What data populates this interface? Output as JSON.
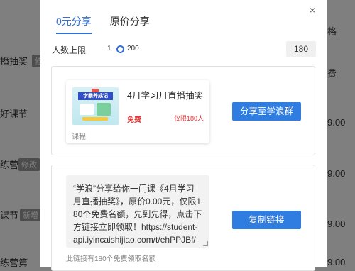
{
  "background": {
    "left_items": [
      "播抽奖",
      "好课节",
      "练营",
      "课节",
      "练营第"
    ],
    "left_tags": [
      "修改",
      "新增"
    ],
    "right_items": [
      "格",
      "费",
      "9.00",
      "9.00",
      "9.00",
      "9.00"
    ]
  },
  "modal": {
    "tabs": [
      {
        "label": "0元分享",
        "active": true
      },
      {
        "label": "原价分享",
        "active": false
      }
    ],
    "close_symbol": "×",
    "limit": {
      "label": "人数上限",
      "min": "1",
      "max": "200",
      "value": "180"
    },
    "card": {
      "thumb_text": "学霸养成记",
      "title": "4月学习月直播抽奖",
      "price": "免费",
      "limit_text": "仅限180人",
      "category": "课程"
    },
    "share_group_button": "分享至学浪群",
    "share_text": "“学浪”分享给你一门课《4月学习月直播抽奖》，原价0.00元，仅限180个免费名额，先到先得，点击下方链接立即领取！https://student-api.iyincaishijiao.com/t/ehPPJBf/",
    "copy_link_button": "复制链接",
    "hint": "此链接有180个免费领取名额"
  }
}
